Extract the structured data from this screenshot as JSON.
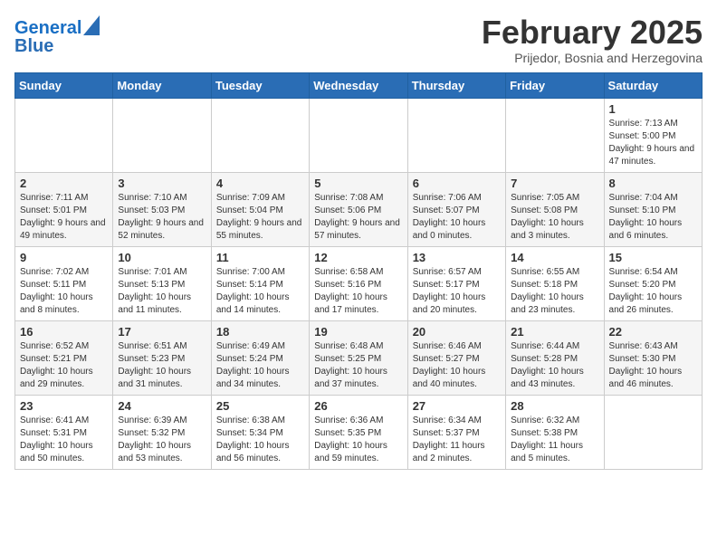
{
  "header": {
    "logo_line1": "General",
    "logo_line2": "Blue",
    "month": "February 2025",
    "location": "Prijedor, Bosnia and Herzegovina"
  },
  "weekdays": [
    "Sunday",
    "Monday",
    "Tuesday",
    "Wednesday",
    "Thursday",
    "Friday",
    "Saturday"
  ],
  "weeks": [
    [
      {
        "day": "",
        "info": ""
      },
      {
        "day": "",
        "info": ""
      },
      {
        "day": "",
        "info": ""
      },
      {
        "day": "",
        "info": ""
      },
      {
        "day": "",
        "info": ""
      },
      {
        "day": "",
        "info": ""
      },
      {
        "day": "1",
        "info": "Sunrise: 7:13 AM\nSunset: 5:00 PM\nDaylight: 9 hours and 47 minutes."
      }
    ],
    [
      {
        "day": "2",
        "info": "Sunrise: 7:11 AM\nSunset: 5:01 PM\nDaylight: 9 hours and 49 minutes."
      },
      {
        "day": "3",
        "info": "Sunrise: 7:10 AM\nSunset: 5:03 PM\nDaylight: 9 hours and 52 minutes."
      },
      {
        "day": "4",
        "info": "Sunrise: 7:09 AM\nSunset: 5:04 PM\nDaylight: 9 hours and 55 minutes."
      },
      {
        "day": "5",
        "info": "Sunrise: 7:08 AM\nSunset: 5:06 PM\nDaylight: 9 hours and 57 minutes."
      },
      {
        "day": "6",
        "info": "Sunrise: 7:06 AM\nSunset: 5:07 PM\nDaylight: 10 hours and 0 minutes."
      },
      {
        "day": "7",
        "info": "Sunrise: 7:05 AM\nSunset: 5:08 PM\nDaylight: 10 hours and 3 minutes."
      },
      {
        "day": "8",
        "info": "Sunrise: 7:04 AM\nSunset: 5:10 PM\nDaylight: 10 hours and 6 minutes."
      }
    ],
    [
      {
        "day": "9",
        "info": "Sunrise: 7:02 AM\nSunset: 5:11 PM\nDaylight: 10 hours and 8 minutes."
      },
      {
        "day": "10",
        "info": "Sunrise: 7:01 AM\nSunset: 5:13 PM\nDaylight: 10 hours and 11 minutes."
      },
      {
        "day": "11",
        "info": "Sunrise: 7:00 AM\nSunset: 5:14 PM\nDaylight: 10 hours and 14 minutes."
      },
      {
        "day": "12",
        "info": "Sunrise: 6:58 AM\nSunset: 5:16 PM\nDaylight: 10 hours and 17 minutes."
      },
      {
        "day": "13",
        "info": "Sunrise: 6:57 AM\nSunset: 5:17 PM\nDaylight: 10 hours and 20 minutes."
      },
      {
        "day": "14",
        "info": "Sunrise: 6:55 AM\nSunset: 5:18 PM\nDaylight: 10 hours and 23 minutes."
      },
      {
        "day": "15",
        "info": "Sunrise: 6:54 AM\nSunset: 5:20 PM\nDaylight: 10 hours and 26 minutes."
      }
    ],
    [
      {
        "day": "16",
        "info": "Sunrise: 6:52 AM\nSunset: 5:21 PM\nDaylight: 10 hours and 29 minutes."
      },
      {
        "day": "17",
        "info": "Sunrise: 6:51 AM\nSunset: 5:23 PM\nDaylight: 10 hours and 31 minutes."
      },
      {
        "day": "18",
        "info": "Sunrise: 6:49 AM\nSunset: 5:24 PM\nDaylight: 10 hours and 34 minutes."
      },
      {
        "day": "19",
        "info": "Sunrise: 6:48 AM\nSunset: 5:25 PM\nDaylight: 10 hours and 37 minutes."
      },
      {
        "day": "20",
        "info": "Sunrise: 6:46 AM\nSunset: 5:27 PM\nDaylight: 10 hours and 40 minutes."
      },
      {
        "day": "21",
        "info": "Sunrise: 6:44 AM\nSunset: 5:28 PM\nDaylight: 10 hours and 43 minutes."
      },
      {
        "day": "22",
        "info": "Sunrise: 6:43 AM\nSunset: 5:30 PM\nDaylight: 10 hours and 46 minutes."
      }
    ],
    [
      {
        "day": "23",
        "info": "Sunrise: 6:41 AM\nSunset: 5:31 PM\nDaylight: 10 hours and 50 minutes."
      },
      {
        "day": "24",
        "info": "Sunrise: 6:39 AM\nSunset: 5:32 PM\nDaylight: 10 hours and 53 minutes."
      },
      {
        "day": "25",
        "info": "Sunrise: 6:38 AM\nSunset: 5:34 PM\nDaylight: 10 hours and 56 minutes."
      },
      {
        "day": "26",
        "info": "Sunrise: 6:36 AM\nSunset: 5:35 PM\nDaylight: 10 hours and 59 minutes."
      },
      {
        "day": "27",
        "info": "Sunrise: 6:34 AM\nSunset: 5:37 PM\nDaylight: 11 hours and 2 minutes."
      },
      {
        "day": "28",
        "info": "Sunrise: 6:32 AM\nSunset: 5:38 PM\nDaylight: 11 hours and 5 minutes."
      },
      {
        "day": "",
        "info": ""
      }
    ]
  ]
}
